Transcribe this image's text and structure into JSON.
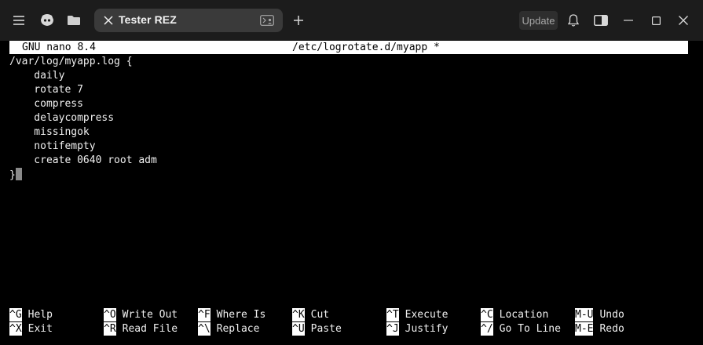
{
  "window": {
    "tab_title": "Tester REZ",
    "update_label": "Update"
  },
  "nano": {
    "version": "GNU nano 8.4",
    "filename": "/etc/logrotate.d/myapp *"
  },
  "editor": {
    "lines": [
      "/var/log/myapp.log {",
      "    daily",
      "    rotate 7",
      "    compress",
      "    delaycompress",
      "    missingok",
      "    notifempty",
      "    create 0640 root adm",
      "}"
    ]
  },
  "shortcuts": {
    "row1": [
      {
        "key": "^G",
        "label": "Help"
      },
      {
        "key": "^O",
        "label": "Write Out"
      },
      {
        "key": "^F",
        "label": "Where Is"
      },
      {
        "key": "^K",
        "label": "Cut"
      },
      {
        "key": "^T",
        "label": "Execute"
      },
      {
        "key": "^C",
        "label": "Location"
      },
      {
        "key": "M-U",
        "label": "Undo"
      }
    ],
    "row2": [
      {
        "key": "^X",
        "label": "Exit"
      },
      {
        "key": "^R",
        "label": "Read File"
      },
      {
        "key": "^\\",
        "label": "Replace"
      },
      {
        "key": "^U",
        "label": "Paste"
      },
      {
        "key": "^J",
        "label": "Justify"
      },
      {
        "key": "^/",
        "label": "Go To Line"
      },
      {
        "key": "M-E",
        "label": "Redo"
      }
    ]
  },
  "icons": {
    "menu": "hamburger-icon",
    "ai": "copilot-icon",
    "folder": "folder-icon",
    "close_tab": "close-icon",
    "terminal": "terminal-icon",
    "new_tab": "plus-icon",
    "notifications": "bell-icon",
    "sidebar": "sidebar-icon",
    "minimize": "minimize-icon",
    "maximize": "maximize-icon",
    "close_window": "close-icon"
  }
}
